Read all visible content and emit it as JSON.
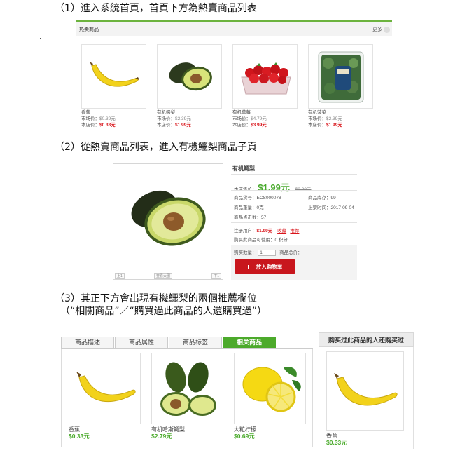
{
  "steps": {
    "step1": "（1）進入系統首頁，首頁下方為熱賣商品列表",
    "step2": "（2）從熱賣商品列表，進入有機鱷梨商品子頁",
    "step3_line1": "（3）其正下方會出現有機鱷梨的兩個推薦欄位",
    "step3_line2": "（“相關商品”／“購買過此商品的人還購買過”）"
  },
  "hot_products": {
    "title": "热卖商品",
    "more": "更多",
    "items": [
      {
        "name": "香蕉",
        "market_label": "市场价：",
        "market_price": "$0.39元",
        "shop_label": "本店价：",
        "shop_price": "$0.33元",
        "icon": "banana-image"
      },
      {
        "name": "有机鳄梨",
        "market_label": "市场价：",
        "market_price": "$2.39元",
        "shop_label": "本店价：",
        "shop_price": "$1.99元",
        "icon": "avocado-image"
      },
      {
        "name": "有机草莓",
        "market_label": "市场价：",
        "market_price": "$4.79元",
        "shop_label": "本店价：",
        "shop_price": "$3.99元",
        "icon": "strawberry-image"
      },
      {
        "name": "有机菠菜",
        "market_label": "市场价：",
        "market_price": "$2.39元",
        "shop_label": "本店价：",
        "shop_price": "$1.99元",
        "icon": "spinach-image"
      }
    ]
  },
  "product_detail": {
    "title": "有机鳄梨",
    "shop_price_label": "本店售价：",
    "shop_price": "$1.99元",
    "market_price": "$2.39元",
    "sku_label": "商品货号：",
    "sku": "ECS000078",
    "stock_label": "商品库存：",
    "stock": "99",
    "weight_label": "商品重量：",
    "weight": "0克",
    "shelf_date_label": "上架时间：",
    "shelf_date": "2017-09-04",
    "clicks_label": "商品点击数：",
    "clicks": "57",
    "member_label": "注册用户：",
    "member_price": "$1.99元",
    "favorite": "收藏",
    "share": "推荐",
    "points_text": "购买此商品可使用：0 积分",
    "qty_label": "购买数量：",
    "qty_value": "1",
    "total_label": "商品总价：",
    "cart_button": "放入购物车",
    "image_footer": [
      "上1",
      "查看大图",
      "下1"
    ]
  },
  "tabs": [
    {
      "label": "商品描述",
      "active": false
    },
    {
      "label": "商品属性",
      "active": false
    },
    {
      "label": "商品标签",
      "active": false
    },
    {
      "label": "相关商品",
      "active": true
    }
  ],
  "related_products": [
    {
      "name": "香蕉",
      "price": "$0.33元",
      "icon": "banana-image"
    },
    {
      "name": "有机哈斯鳄梨",
      "price": "$2.79元",
      "icon": "avocado-image"
    },
    {
      "name": "大粒柠檬",
      "price": "$0.69元",
      "icon": "lemon-image"
    }
  ],
  "also_bought": {
    "title": "购买过此商品的人还购买过",
    "items": [
      {
        "name": "香蕉",
        "price": "$0.33元",
        "icon": "banana-image"
      }
    ]
  },
  "colors": {
    "accent_green": "#4caa2b",
    "price_red": "#d9151b",
    "button_red": "#c8161d"
  }
}
